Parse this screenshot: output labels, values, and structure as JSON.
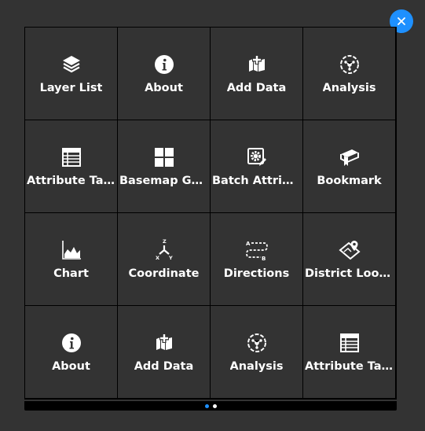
{
  "colors": {
    "background": "#333333",
    "accent": "#1e90ff",
    "text": "#ffffff"
  },
  "close_icon": "close-icon",
  "tiles": [
    {
      "label": "Layer List",
      "icon": "layers-icon"
    },
    {
      "label": "About",
      "icon": "info-icon"
    },
    {
      "label": "Add Data",
      "icon": "add-data-icon"
    },
    {
      "label": "Analysis",
      "icon": "analysis-icon"
    },
    {
      "label": "Attribute Table",
      "icon": "table-icon"
    },
    {
      "label": "Basemap Gall...",
      "icon": "basemap-grid-icon"
    },
    {
      "label": "Batch Attribu...",
      "icon": "batch-gear-icon"
    },
    {
      "label": "Bookmark",
      "icon": "bookmark-icon"
    },
    {
      "label": "Chart",
      "icon": "chart-icon"
    },
    {
      "label": "Coordinate",
      "icon": "xyz-axes-icon"
    },
    {
      "label": "Directions",
      "icon": "directions-icon"
    },
    {
      "label": "District Lookup",
      "icon": "map-pin-icon"
    },
    {
      "label": "About",
      "icon": "info-icon"
    },
    {
      "label": "Add Data",
      "icon": "add-data-icon"
    },
    {
      "label": "Analysis",
      "icon": "analysis-icon"
    },
    {
      "label": "Attribute Table",
      "icon": "table-icon"
    }
  ],
  "pager": {
    "pages": 2,
    "active_page": 1
  }
}
